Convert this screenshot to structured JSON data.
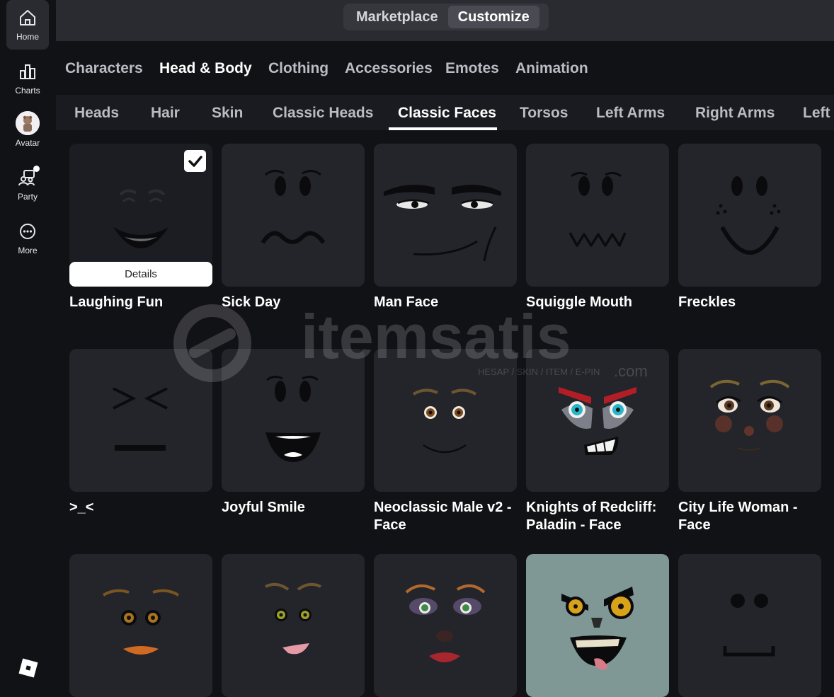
{
  "nav": {
    "items": [
      {
        "label": "Home",
        "icon": "home-icon"
      },
      {
        "label": "Charts",
        "icon": "charts-icon"
      },
      {
        "label": "Avatar",
        "icon": "avatar-icon"
      },
      {
        "label": "Party",
        "icon": "party-icon"
      },
      {
        "label": "More",
        "icon": "more-icon"
      }
    ]
  },
  "topbar": {
    "marketplace": "Marketplace",
    "customize": "Customize"
  },
  "categories": [
    "Characters",
    "Head & Body",
    "Clothing",
    "Accessories",
    "Emotes",
    "Animation"
  ],
  "subcategories": [
    "Heads",
    "Hair",
    "Skin",
    "Classic Heads",
    "Classic Faces",
    "Torsos",
    "Left Arms",
    "Right Arms",
    "Left"
  ],
  "items": [
    {
      "name": "Laughing Fun",
      "face": "laughing",
      "equipped": true
    },
    {
      "name": "Sick Day",
      "face": "sick"
    },
    {
      "name": "Man Face",
      "face": "man"
    },
    {
      "name": "Squiggle Mouth",
      "face": "squiggle"
    },
    {
      "name": "Freckles",
      "face": "freckles"
    },
    {
      "name": ">_<",
      "face": "squint"
    },
    {
      "name": "Joyful Smile",
      "face": "joyful"
    },
    {
      "name": "Neoclassic Male v2 - Face",
      "face": "neoclassic"
    },
    {
      "name": "Knights of Redcliff: Paladin - Face",
      "face": "paladin"
    },
    {
      "name": "City Life Woman - Face",
      "face": "citylife"
    },
    {
      "name": "",
      "face": "woman-orange"
    },
    {
      "name": "",
      "face": "woman-green"
    },
    {
      "name": "",
      "face": "woman-purple"
    },
    {
      "name": "",
      "face": "zombie"
    },
    {
      "name": "",
      "face": "dots"
    }
  ],
  "details_label": "Details",
  "watermark": {
    "brand": "itemsatis",
    "tagline": "HESAP / SKIN / ITEM / E-PIN",
    "suffix": ".com"
  },
  "colors": {
    "bg": "#111216",
    "card": "#24252b",
    "topbar": "#2a2b30",
    "accent": "#ffffff"
  }
}
